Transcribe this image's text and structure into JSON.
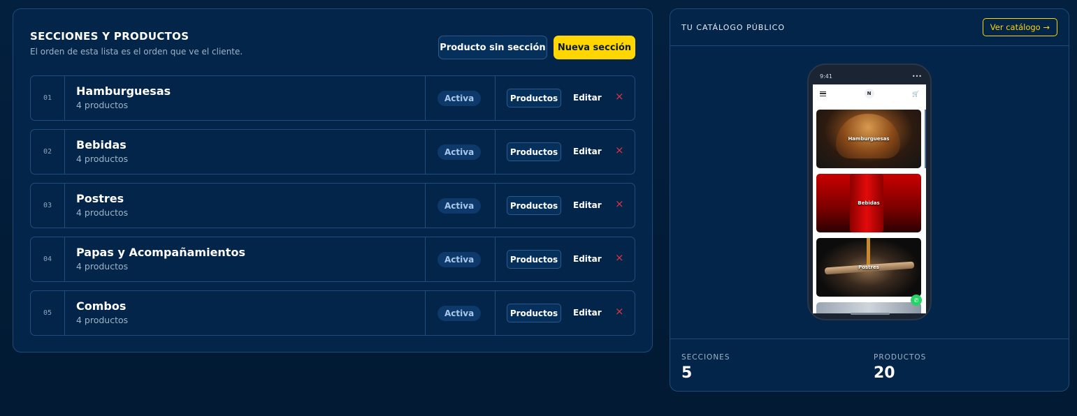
{
  "sections_panel": {
    "title": "SECCIONES Y PRODUCTOS",
    "subtitle": "El orden de esta lista es el orden que ve el cliente.",
    "product_no_section_label": "Producto sin sección",
    "new_section_label": "Nueva sección",
    "rows": [
      {
        "num": "01",
        "name": "Hamburguesas",
        "count": "4 productos",
        "status": "Activa",
        "products_label": "Productos",
        "edit_label": "Editar",
        "delete_icon": "×"
      },
      {
        "num": "02",
        "name": "Bebidas",
        "count": "4 productos",
        "status": "Activa",
        "products_label": "Productos",
        "edit_label": "Editar",
        "delete_icon": "×"
      },
      {
        "num": "03",
        "name": "Postres",
        "count": "4 productos",
        "status": "Activa",
        "products_label": "Productos",
        "edit_label": "Editar",
        "delete_icon": "×"
      },
      {
        "num": "04",
        "name": "Papas y Acompañamientos",
        "count": "4 productos",
        "status": "Activa",
        "products_label": "Productos",
        "edit_label": "Editar",
        "delete_icon": "×"
      },
      {
        "num": "05",
        "name": "Combos",
        "count": "4 productos",
        "status": "Activa",
        "products_label": "Productos",
        "edit_label": "Editar",
        "delete_icon": "×"
      }
    ]
  },
  "catalog_panel": {
    "title": "TU CATÁLOGO PÚBLICO",
    "view_label": "Ver catálogo →",
    "phone": {
      "time": "9:41",
      "status_dots": "•••",
      "logo_letter": "N",
      "cart_glyph": "🛒",
      "whatsapp_glyph": "✆",
      "cards": [
        "Hamburguesas",
        "Bebidas",
        "Postres"
      ]
    },
    "stats": {
      "sections_label": "SECCIONES",
      "sections_value": "5",
      "products_label": "PRODUCTOS",
      "products_value": "20"
    }
  },
  "colors": {
    "background": "#03203f",
    "panel": "#032549",
    "accent_yellow": "#ffd600",
    "delete_red": "#e0344a",
    "badge_bg": "#0d3a6a"
  }
}
